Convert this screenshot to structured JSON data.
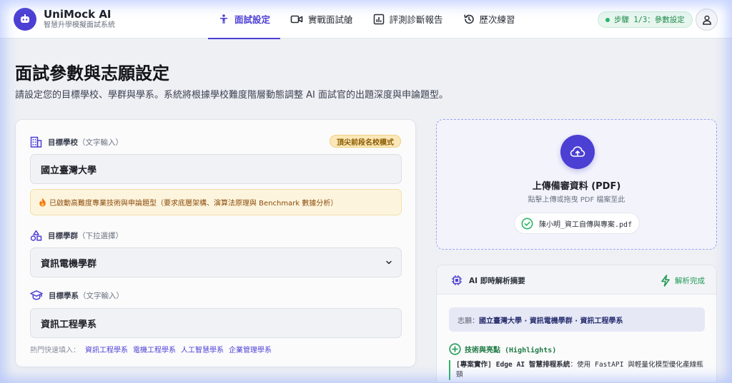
{
  "brand": {
    "name": "UniMock AI",
    "tagline": "智慧升學模擬面試系統"
  },
  "nav": {
    "tabs": [
      {
        "label": "面試設定",
        "icon": "person-icon",
        "active": true
      },
      {
        "label": "實戰面試艙",
        "icon": "video-icon",
        "active": false
      },
      {
        "label": "評測診斷報告",
        "icon": "chart-icon",
        "active": false
      },
      {
        "label": "歷次練習",
        "icon": "history-icon",
        "active": false
      }
    ],
    "step_badge": "步驟 1/3：參數設定"
  },
  "page": {
    "title": "面試參數與志願設定",
    "description": "請設定您的目標學校、學群與學系。系統將根據學校難度階層動態調整 AI 面試官的出題深度與申論題型。"
  },
  "form": {
    "school": {
      "label": "目標學校",
      "hint": "（文字輸入）",
      "value": "國立臺灣大學",
      "tag": "頂尖前段名校模式"
    },
    "notice": "已啟動高難度專業技術與申論題型（要求底層架構、演算法原理與 Benchmark 數據分析）",
    "group": {
      "label": "目標學群",
      "hint": "（下拉選擇）",
      "value": "資訊電機學群"
    },
    "department": {
      "label": "目標學系",
      "hint": "（文字輸入）",
      "value": "資訊工程學系"
    },
    "quick_picks": {
      "label": "熱門快速填入：",
      "items": [
        "資訊工程學系",
        "電機工程學系",
        "人工智慧學系",
        "企業管理學系"
      ]
    }
  },
  "upload": {
    "title": "上傳備審資料 (PDF)",
    "subtitle": "點擊上傳或拖曳 PDF 檔案至此",
    "file_name": "陳小明_資工自傳與專案.pdf"
  },
  "ai_summary": {
    "title": "AI 即時解析摘要",
    "status": "解析完成",
    "wish_label": "志願：",
    "wish_value": "國立臺灣大學 · 資訊電機學群 · 資訊工程學系",
    "highlights_title": "技術與亮點 (Highlights)",
    "highlight_tag": "[專案實作] Edge AI 智慧排程系統",
    "highlight_text": "：使用 FastAPI 與輕量化模型優化產線瓶頸"
  },
  "colors": {
    "accent": "#4c3fd3",
    "success": "#2bb567",
    "warning_bg": "#fdf4dd"
  }
}
